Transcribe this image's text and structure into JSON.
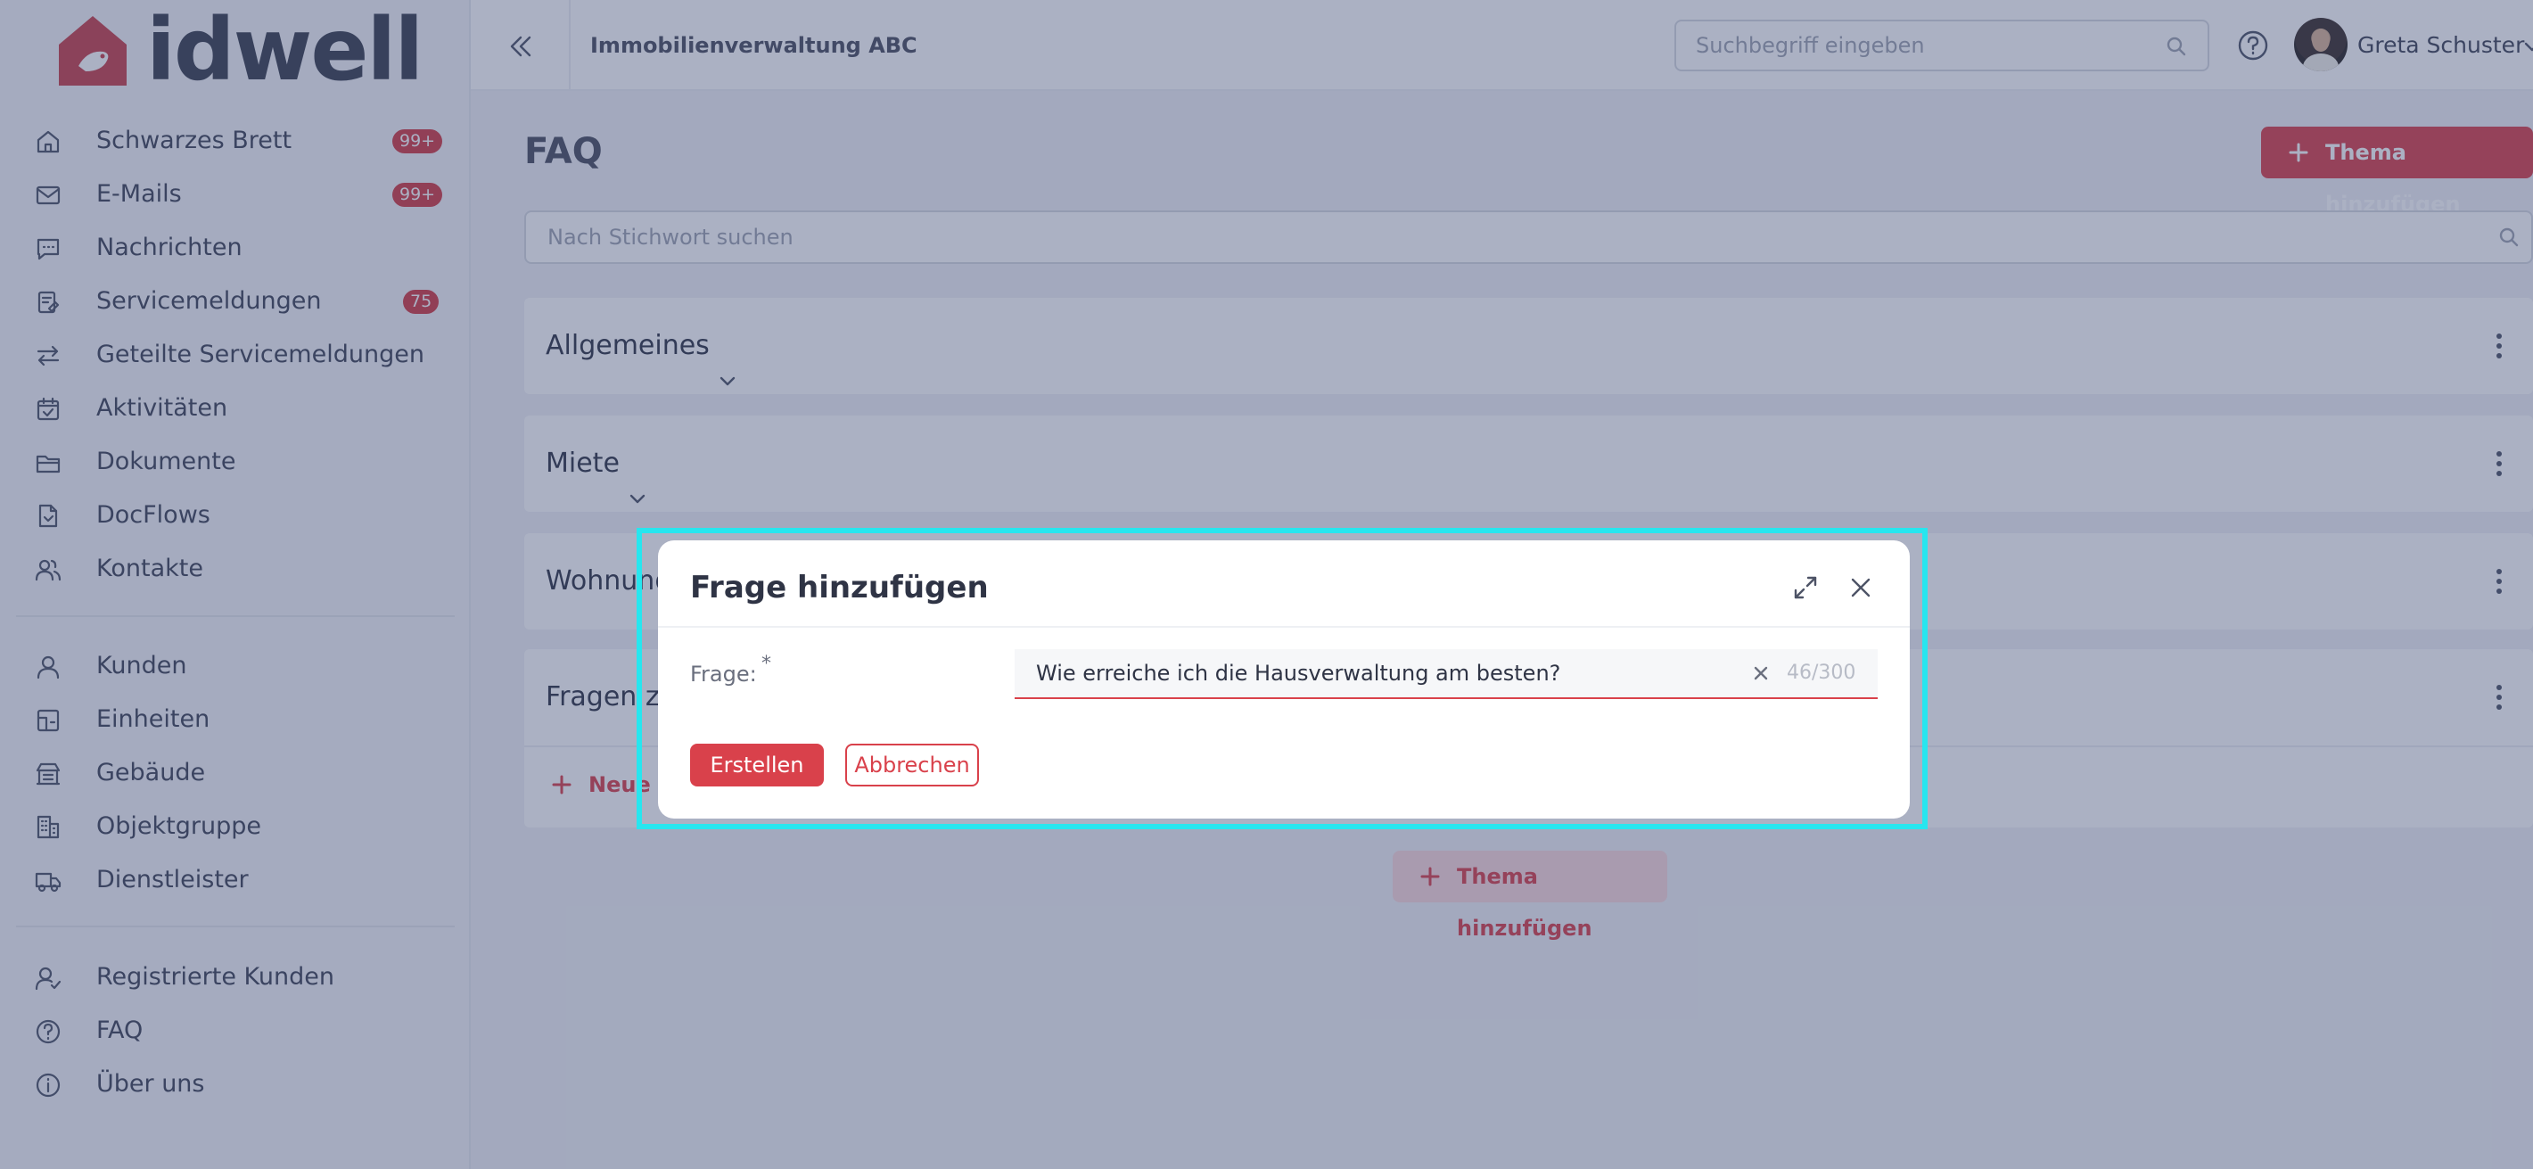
{
  "brand": {
    "name": "idwell",
    "accent": "#d9414b"
  },
  "sidebar": {
    "groups": [
      [
        {
          "label": "Schwarzes Brett",
          "badge": "99+",
          "icon": "home-icon"
        },
        {
          "label": "E-Mails",
          "badge": "99+",
          "icon": "mail-icon"
        },
        {
          "label": "Nachrichten",
          "badge": "",
          "icon": "chat-icon"
        },
        {
          "label": "Servicemeldungen",
          "badge": "75",
          "icon": "service-report-icon"
        },
        {
          "label": "Geteilte Servicemeldungen",
          "badge": "",
          "icon": "swap-arrows-icon"
        },
        {
          "label": "Aktivitäten",
          "badge": "",
          "icon": "calendar-check-icon"
        },
        {
          "label": "Dokumente",
          "badge": "",
          "icon": "folder-icon"
        },
        {
          "label": "DocFlows",
          "badge": "",
          "icon": "docflow-icon"
        },
        {
          "label": "Kontakte",
          "badge": "",
          "icon": "contacts-icon"
        }
      ],
      [
        {
          "label": "Kunden",
          "badge": "",
          "icon": "user-icon"
        },
        {
          "label": "Einheiten",
          "badge": "",
          "icon": "unit-icon"
        },
        {
          "label": "Gebäude",
          "badge": "",
          "icon": "building-icon"
        },
        {
          "label": "Objektgruppe",
          "badge": "",
          "icon": "property-group-icon"
        },
        {
          "label": "Dienstleister",
          "badge": "",
          "icon": "truck-icon"
        }
      ],
      [
        {
          "label": "Registrierte Kunden",
          "badge": "",
          "icon": "user-check-icon"
        },
        {
          "label": "FAQ",
          "badge": "",
          "icon": "help-circle-icon"
        },
        {
          "label": "Über uns",
          "badge": "",
          "icon": "info-icon"
        }
      ]
    ]
  },
  "header": {
    "organization": "Immobilienverwaltung ABC",
    "search_placeholder": "Suchbegriff eingeben",
    "user_name": "Greta Schuster"
  },
  "main": {
    "title": "FAQ",
    "add_topic_label": "Thema hinzufügen",
    "keyword_placeholder": "Nach Stichwort suchen",
    "topics": [
      {
        "title": "Allgemeines",
        "expanded": false
      },
      {
        "title": "Miete",
        "expanded": false
      },
      {
        "title": "Wohnung",
        "expanded": false
      },
      {
        "title": "Fragen zu",
        "expanded": true,
        "new_question_label": "Neue F"
      }
    ],
    "bottom_add_topic_label": "Thema hinzufügen"
  },
  "modal": {
    "title": "Frage hinzufügen",
    "field_label": "Frage:",
    "required_mark": "*",
    "field_value": "Wie erreiche ich die Hausverwaltung am besten?",
    "counter": "46/300",
    "create_label": "Erstellen",
    "cancel_label": "Abbrechen"
  }
}
